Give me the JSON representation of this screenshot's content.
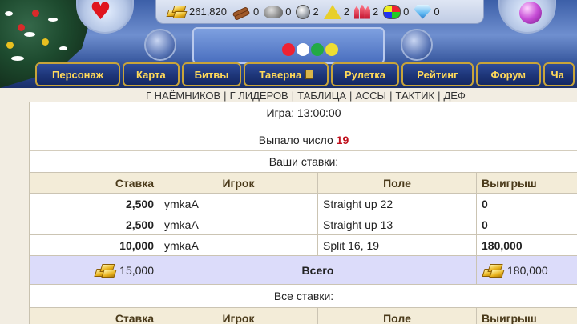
{
  "resources": [
    {
      "icon": "gold-icon",
      "value": "261,820"
    },
    {
      "icon": "wood-icon",
      "value": "0"
    },
    {
      "icon": "ore-icon",
      "value": "0"
    },
    {
      "icon": "mercury-icon",
      "value": "2"
    },
    {
      "icon": "sulfur-icon",
      "value": "2"
    },
    {
      "icon": "crystal-icon",
      "value": "2"
    },
    {
      "icon": "gems-icon",
      "value": "0"
    },
    {
      "icon": "diamond-icon",
      "value": "0"
    }
  ],
  "nav": [
    {
      "label": "Персонаж"
    },
    {
      "label": "Карта"
    },
    {
      "label": "Битвы"
    },
    {
      "label": "Таверна"
    },
    {
      "label": "Рулетка"
    },
    {
      "label": "Рейтинг"
    },
    {
      "label": "Форум"
    },
    {
      "label": "Ча"
    }
  ],
  "links": [
    "Г НАЁМНИКОВ",
    "Г ЛИДЕРОВ",
    "ТАБЛИЦА",
    "АССЫ",
    "ТАКТИК",
    "ДЕФ"
  ],
  "game": {
    "time_line": "Игра: 13:00:00",
    "result_prefix": "Выпало число",
    "result_number": "19"
  },
  "your_bets": {
    "title": "Ваши ставки:",
    "headers": {
      "stake": "Ставка",
      "player": "Игрок",
      "field": "Поле",
      "win": "Выигрыш"
    },
    "rows": [
      {
        "stake": "2,500",
        "player": "ymkaA",
        "field": "Straight up 22",
        "win": "0"
      },
      {
        "stake": "2,500",
        "player": "ymkaA",
        "field": "Straight up 13",
        "win": "0"
      },
      {
        "stake": "10,000",
        "player": "ymkaA",
        "field": "Split 16, 19",
        "win": "180,000"
      }
    ],
    "total": {
      "stake": "15,000",
      "label": "Всего",
      "win": "180,000"
    }
  },
  "all_bets": {
    "title": "Все ставки:",
    "headers": {
      "stake": "Ставка",
      "player": "Игрок",
      "field": "Поле",
      "win": "Выигрыш"
    }
  },
  "colors": {
    "accent_gold": "#ffd95a",
    "nav_bg": "#1d3578",
    "winning_number": "#c0101c",
    "total_row": "#dcdcfa"
  }
}
